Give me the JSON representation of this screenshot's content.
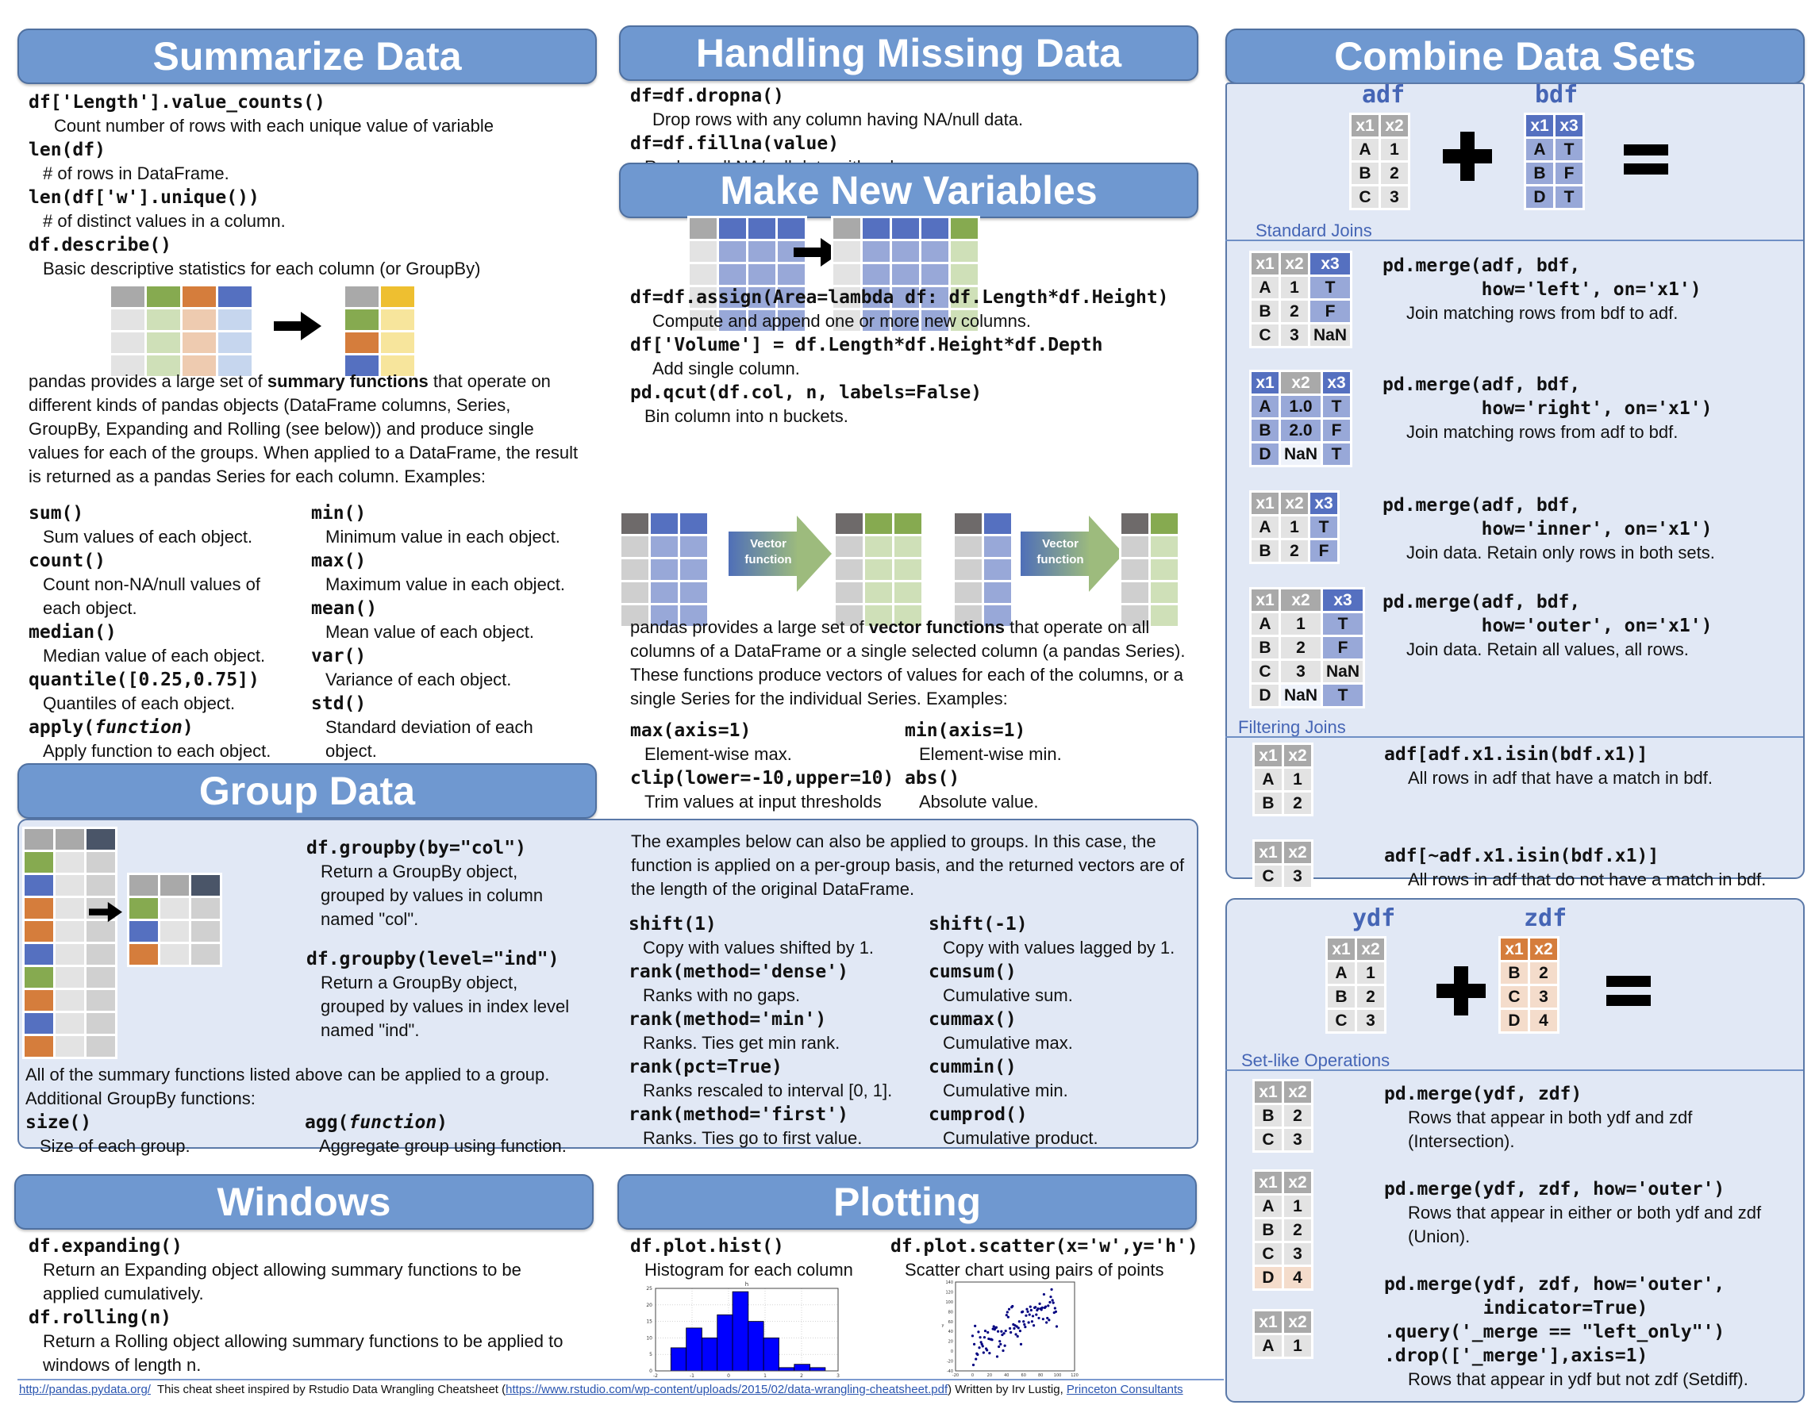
{
  "sections": {
    "summarize": {
      "title": "Summarize Data",
      "items": [
        {
          "code": "df['Length'].value_counts()",
          "desc": "Count number of rows with each unique value of variable"
        },
        {
          "code": "len(df)",
          "desc": "# of rows in DataFrame."
        },
        {
          "code": "len(df['w'].unique())",
          "desc": "# of distinct values in a column."
        },
        {
          "code": "df.describe()",
          "desc": "Basic descriptive statistics for each column (or GroupBy)"
        }
      ],
      "para_pre": "pandas provides a large set of ",
      "para_bold": "summary functions",
      "para_post": " that operate on different kinds of pandas objects (DataFrame columns, Series, GroupBy, Expanding and Rolling (see below)) and produce single values for each of the groups. When applied to a DataFrame, the result is returned as a pandas Series for each column. Examples:",
      "functions_left": [
        {
          "code": "sum()",
          "desc": "Sum values of each object."
        },
        {
          "code": "count()",
          "desc": "Count non-NA/null values of each object."
        },
        {
          "code": "median()",
          "desc": "Median value of each object."
        },
        {
          "code": "quantile([0.25,0.75])",
          "desc": "Quantiles of each object."
        },
        {
          "code_pre": "apply(",
          "code_italic": "function",
          "code_post": ")",
          "desc": "Apply function to each object."
        }
      ],
      "functions_right": [
        {
          "code": "min()",
          "desc": "Minimum value in each object."
        },
        {
          "code": "max()",
          "desc": "Maximum value in each object."
        },
        {
          "code": "mean()",
          "desc": "Mean value of each object."
        },
        {
          "code": "var()",
          "desc": "Variance of each object."
        },
        {
          "code": "std()",
          "desc": "Standard deviation of each object."
        }
      ]
    },
    "group": {
      "title": "Group Data",
      "items": [
        {
          "code": "df.groupby(by=\"col\")",
          "desc": "Return a GroupBy object, grouped by values in column named \"col\"."
        },
        {
          "code": "df.groupby(level=\"ind\")",
          "desc": "Return a GroupBy object, grouped by values in index level named \"ind\"."
        }
      ],
      "note1": "All of the summary functions listed above can be applied to a group.",
      "note2": "Additional GroupBy functions:",
      "size": {
        "code": "size()",
        "desc": "Size of each group."
      },
      "agg": {
        "code_pre": "agg(",
        "code_italic": "function",
        "code_post": ")",
        "desc": "Aggregate group using function."
      },
      "group_note": "The examples below can also be applied to groups. In this case, the function is applied on a per-group basis, and the returned vectors are of the length of the original DataFrame.",
      "functions_left": [
        {
          "code": "shift(1)",
          "desc": "Copy with values shifted by 1."
        },
        {
          "code": "rank(method='dense')",
          "desc": "Ranks with no gaps."
        },
        {
          "code": "rank(method='min')",
          "desc": "Ranks. Ties get min rank."
        },
        {
          "code": "rank(pct=True)",
          "desc": "Ranks rescaled to interval [0, 1]."
        },
        {
          "code": "rank(method='first')",
          "desc": "Ranks. Ties go to first value."
        }
      ],
      "functions_right": [
        {
          "code": "shift(-1)",
          "desc": "Copy with values lagged by 1."
        },
        {
          "code": "cumsum()",
          "desc": "Cumulative sum."
        },
        {
          "code": "cummax()",
          "desc": "Cumulative max."
        },
        {
          "code": "cummin()",
          "desc": "Cumulative min."
        },
        {
          "code": "cumprod()",
          "desc": "Cumulative product."
        }
      ]
    },
    "windows": {
      "title": "Windows",
      "items": [
        {
          "code": "df.expanding()",
          "desc": "Return an Expanding object allowing summary functions to be applied cumulatively."
        },
        {
          "code": "df.rolling(n)",
          "desc": "Return a Rolling object allowing summary functions to be applied to windows of length n."
        }
      ]
    },
    "missing": {
      "title": "Handling Missing Data",
      "items": [
        {
          "code": "df=df.dropna()",
          "desc": "Drop rows with any column having NA/null data."
        },
        {
          "code": "df=df.fillna(value)",
          "desc": "Replace all NA/null data with value."
        }
      ]
    },
    "newvars": {
      "title": "Make New Variables",
      "items": [
        {
          "code": "df=df.assign(Area=lambda df: df.Length*df.Height)",
          "desc": "Compute and append one or more new columns."
        },
        {
          "code": "df['Volume'] = df.Length*df.Height*df.Depth",
          "desc": "Add single column."
        },
        {
          "code": "pd.qcut(df.col, n, labels=False)",
          "desc": "Bin column into n buckets."
        }
      ],
      "vector_label_1": "Vector",
      "vector_label_2": "function",
      "para_pre": "pandas provides a large set of ",
      "para_bold": "vector functions",
      "para_post": " that operate on all columns of a DataFrame or a single selected column (a pandas Series). These functions produce vectors of values for each of the columns, or a single Series for the individual Series. Examples:",
      "functions_left": [
        {
          "code": "max(axis=1)",
          "desc": "Element-wise max."
        },
        {
          "code": "clip(lower=-10,upper=10)",
          "desc": "Trim values at input thresholds"
        }
      ],
      "functions_right": [
        {
          "code": "min(axis=1)",
          "desc": "Element-wise min."
        },
        {
          "code": "abs()",
          "desc": "Absolute value."
        }
      ]
    },
    "plotting": {
      "title": "Plotting",
      "hist": {
        "code": "df.plot.hist()",
        "desc": "Histogram for each column"
      },
      "scatter": {
        "code": "df.plot.scatter(x='w',y='h')",
        "desc": "Scatter chart using pairs of points"
      }
    },
    "combine": {
      "title": "Combine Data Sets",
      "adf_label": "adf",
      "bdf_label": "bdf",
      "adf": {
        "cols": [
          "x1",
          "x2"
        ],
        "rows": [
          [
            "A",
            "1"
          ],
          [
            "B",
            "2"
          ],
          [
            "C",
            "3"
          ]
        ]
      },
      "bdf": {
        "cols": [
          "x1",
          "x3"
        ],
        "rows": [
          [
            "A",
            "T"
          ],
          [
            "B",
            "F"
          ],
          [
            "D",
            "T"
          ]
        ]
      },
      "standard_joins_label": "Standard Joins",
      "joins": [
        {
          "code1": "pd.merge(adf, bdf,",
          "code2": "         how='left', on='x1')",
          "desc": "Join matching rows from bdf to adf.",
          "cols": [
            "x1",
            "x2",
            "x3"
          ],
          "rows": [
            [
              "A",
              "1",
              "T"
            ],
            [
              "B",
              "2",
              "F"
            ],
            [
              "C",
              "3",
              "NaN"
            ]
          ]
        },
        {
          "code1": "pd.merge(adf, bdf,",
          "code2": "         how='right', on='x1')",
          "desc": "Join matching rows from adf to bdf.",
          "cols": [
            "x1",
            "x2",
            "x3"
          ],
          "rows": [
            [
              "A",
              "1.0",
              "T"
            ],
            [
              "B",
              "2.0",
              "F"
            ],
            [
              "D",
              "NaN",
              "T"
            ]
          ]
        },
        {
          "code1": "pd.merge(adf, bdf,",
          "code2": "         how='inner', on='x1')",
          "desc": "Join data. Retain only rows in both sets.",
          "cols": [
            "x1",
            "x2",
            "x3"
          ],
          "rows": [
            [
              "A",
              "1",
              "T"
            ],
            [
              "B",
              "2",
              "F"
            ]
          ]
        },
        {
          "code1": "pd.merge(adf, bdf,",
          "code2": "         how='outer', on='x1')",
          "desc": "Join data. Retain all values, all rows.",
          "cols": [
            "x1",
            "x2",
            "x3"
          ],
          "rows": [
            [
              "A",
              "1",
              "T"
            ],
            [
              "B",
              "2",
              "F"
            ],
            [
              "C",
              "3",
              "NaN"
            ],
            [
              "D",
              "NaN",
              "T"
            ]
          ]
        }
      ],
      "filtering_joins_label": "Filtering Joins",
      "filters": [
        {
          "code": "adf[adf.x1.isin(bdf.x1)]",
          "desc": "All rows in adf that have a match in bdf.",
          "cols": [
            "x1",
            "x2"
          ],
          "rows": [
            [
              "A",
              "1"
            ],
            [
              "B",
              "2"
            ]
          ]
        },
        {
          "code": "adf[~adf.x1.isin(bdf.x1)]",
          "desc": "All rows in adf that do not have a match in bdf.",
          "cols": [
            "x1",
            "x2"
          ],
          "rows": [
            [
              "C",
              "3"
            ]
          ]
        }
      ],
      "ydf_label": "ydf",
      "zdf_label": "zdf",
      "ydf": {
        "cols": [
          "x1",
          "x2"
        ],
        "rows": [
          [
            "A",
            "1"
          ],
          [
            "B",
            "2"
          ],
          [
            "C",
            "3"
          ]
        ]
      },
      "zdf": {
        "cols": [
          "x1",
          "x2"
        ],
        "rows": [
          [
            "B",
            "2"
          ],
          [
            "C",
            "3"
          ],
          [
            "D",
            "4"
          ]
        ]
      },
      "setlike_label": "Set-like Operations",
      "setops": [
        {
          "code_lines": [
            "pd.merge(ydf, zdf)"
          ],
          "desc_lines": [
            "Rows that appear in both ydf and zdf",
            "(Intersection)."
          ],
          "cols": [
            "x1",
            "x2"
          ],
          "rows": [
            [
              "B",
              "2"
            ],
            [
              "C",
              "3"
            ]
          ]
        },
        {
          "code_lines": [
            "pd.merge(ydf, zdf, how='outer')"
          ],
          "desc_lines": [
            "Rows that appear in either or both ydf and zdf",
            "(Union)."
          ],
          "cols": [
            "x1",
            "x2"
          ],
          "rows": [
            [
              "A",
              "1"
            ],
            [
              "B",
              "2"
            ],
            [
              "C",
              "3"
            ],
            [
              "D",
              "4"
            ]
          ]
        },
        {
          "code_lines": [
            "pd.merge(ydf, zdf, how='outer',",
            "         indicator=True)",
            ".query('_merge == \"left_only\"')",
            ".drop(['_merge'],axis=1)"
          ],
          "desc_lines": [
            "Rows that appear in ydf but not zdf (Setdiff)."
          ],
          "cols": [
            "x1",
            "x2"
          ],
          "rows": [
            [
              "A",
              "1"
            ]
          ]
        }
      ]
    }
  },
  "footer": {
    "link1": "http://pandas.pydata.org/",
    "text1": "  This cheat sheet inspired by Rstudio Data Wrangling Cheatsheet (",
    "link2": "https://www.rstudio.com/wp-content/uploads/2015/02/data-wrangling-cheatsheet.pdf",
    "text2": ") Written by Irv Lustig, ",
    "link3": "Princeton Consultants"
  },
  "colors": {
    "header_fill": "#6f98d0",
    "panel_fill": "#e1e8f5",
    "accent_text": "#4565b5",
    "gray": "#a9a9a9",
    "blue": "#5570c0",
    "green": "#86aa50",
    "orange": "#d57d3c",
    "yellow": "#eebf30"
  },
  "chart_data": [
    {
      "type": "bar",
      "title": "h",
      "xlabel": "",
      "ylabel": "",
      "bin_edges": [
        -1.58,
        -1.16,
        -0.73,
        -0.31,
        0.11,
        0.54,
        0.96,
        1.38,
        1.8,
        2.23,
        2.65
      ],
      "values": [
        7,
        13,
        10,
        17,
        24,
        15,
        10,
        1,
        2,
        1
      ],
      "xlim": [
        -2,
        3
      ],
      "ylim": [
        0,
        25
      ],
      "xticks": [
        "-2",
        "-1",
        "0",
        "1",
        "2",
        "3"
      ],
      "yticks": [
        "0",
        "5",
        "10",
        "15",
        "20",
        "25"
      ],
      "grid": true
    },
    {
      "type": "scatter",
      "title": "",
      "xlabel": "x",
      "ylabel": "y",
      "xlim": [
        -20,
        120
      ],
      "ylim": [
        -40,
        140
      ],
      "xticks": [
        "-20",
        "0",
        "20",
        "40",
        "60",
        "80",
        "100",
        "120"
      ],
      "yticks": [
        "-40",
        "-20",
        "0",
        "20",
        "40",
        "60",
        "80",
        "100",
        "120",
        "140"
      ],
      "grid": false,
      "points": [
        [
          0,
          31
        ],
        [
          1,
          -28
        ],
        [
          2,
          14
        ],
        [
          3,
          51
        ],
        [
          4,
          -16
        ],
        [
          5,
          -5
        ],
        [
          6,
          -7
        ],
        [
          7,
          39
        ],
        [
          8,
          7
        ],
        [
          9,
          28
        ],
        [
          10,
          18
        ],
        [
          11,
          14
        ],
        [
          12,
          10
        ],
        [
          13,
          -3
        ],
        [
          14,
          28
        ],
        [
          15,
          41
        ],
        [
          16,
          5
        ],
        [
          17,
          2
        ],
        [
          18,
          38
        ],
        [
          19,
          25
        ],
        [
          20,
          -4
        ],
        [
          21,
          24
        ],
        [
          22,
          24
        ],
        [
          23,
          23
        ],
        [
          24,
          45
        ],
        [
          25,
          50
        ],
        [
          26,
          44
        ],
        [
          27,
          47
        ],
        [
          28,
          48
        ],
        [
          29,
          -11
        ],
        [
          30,
          40
        ],
        [
          31,
          9
        ],
        [
          32,
          20
        ],
        [
          33,
          14
        ],
        [
          34,
          40
        ],
        [
          35,
          33
        ],
        [
          36,
          1
        ],
        [
          37,
          36
        ],
        [
          38,
          11
        ],
        [
          39,
          41
        ],
        [
          40,
          73
        ],
        [
          41,
          79
        ],
        [
          42,
          69
        ],
        [
          43,
          85
        ],
        [
          44,
          46
        ],
        [
          45,
          38
        ],
        [
          46,
          89
        ],
        [
          47,
          91
        ],
        [
          48,
          54
        ],
        [
          49,
          46
        ],
        [
          50,
          52
        ],
        [
          51,
          34
        ],
        [
          52,
          50
        ],
        [
          53,
          30
        ],
        [
          54,
          47
        ],
        [
          55,
          60
        ],
        [
          56,
          41
        ],
        [
          57,
          14
        ],
        [
          58,
          79
        ],
        [
          59,
          80
        ],
        [
          60,
          60
        ],
        [
          61,
          54
        ],
        [
          62,
          49
        ],
        [
          63,
          72
        ],
        [
          64,
          85
        ],
        [
          65,
          80
        ],
        [
          66,
          58
        ],
        [
          67,
          74
        ],
        [
          68,
          90
        ],
        [
          69,
          83
        ],
        [
          70,
          60
        ],
        [
          71,
          71
        ],
        [
          72,
          52
        ],
        [
          73,
          88
        ],
        [
          74,
          89
        ],
        [
          75,
          74
        ],
        [
          76,
          83
        ],
        [
          77,
          86
        ],
        [
          78,
          67
        ],
        [
          79,
          96
        ],
        [
          80,
          86
        ],
        [
          81,
          84
        ],
        [
          82,
          88
        ],
        [
          83,
          65
        ],
        [
          84,
          115
        ],
        [
          85,
          88
        ],
        [
          86,
          90
        ],
        [
          87,
          58
        ],
        [
          88,
          67
        ],
        [
          89,
          92
        ],
        [
          90,
          63
        ],
        [
          91,
          99
        ],
        [
          92,
          110
        ],
        [
          93,
          125
        ],
        [
          94,
          103
        ],
        [
          95,
          98
        ],
        [
          96,
          78
        ],
        [
          97,
          87
        ],
        [
          98,
          80
        ],
        [
          99,
          50
        ]
      ]
    }
  ]
}
